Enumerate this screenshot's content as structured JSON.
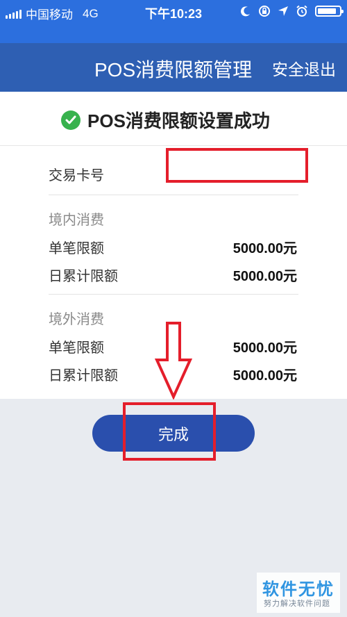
{
  "status_bar": {
    "carrier": "中国移动",
    "network": "4G",
    "time": "下午10:23"
  },
  "header": {
    "title": "POS消费限额管理",
    "logout_label": "安全退出"
  },
  "banner": {
    "text": "POS消费限额设置成功"
  },
  "card": {
    "card_number_label": "交易卡号",
    "card_number_value": "",
    "domestic": {
      "title": "境内消费",
      "single_label": "单笔限额",
      "single_value": "5000.00元",
      "daily_label": "日累计限额",
      "daily_value": "5000.00元"
    },
    "overseas": {
      "title": "境外消费",
      "single_label": "单笔限额",
      "single_value": "5000.00元",
      "daily_label": "日累计限额",
      "daily_value": "5000.00元"
    }
  },
  "done_button": "完成",
  "watermark": {
    "main": "软件无忧",
    "sub": "努力解决软件问题"
  },
  "colors": {
    "accent": "#2c6fde",
    "header_bar": "#2e5fb3",
    "button": "#2a4fad",
    "success": "#37b24d",
    "annotation_red": "#e41e2b"
  }
}
